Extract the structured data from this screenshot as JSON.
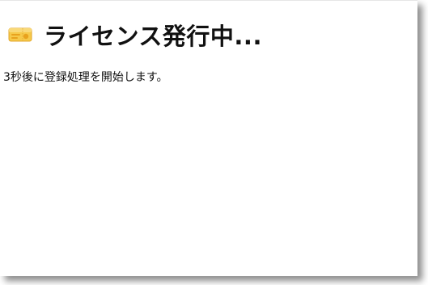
{
  "dialog": {
    "title": "ライセンス発行中...",
    "icon": "ticket-icon",
    "message": "3秒後に登録処理を開始します。"
  },
  "colors": {
    "icon_fill": "#f6c94a",
    "icon_accent": "#e8a21e",
    "text": "#111111",
    "background": "#ffffff"
  }
}
